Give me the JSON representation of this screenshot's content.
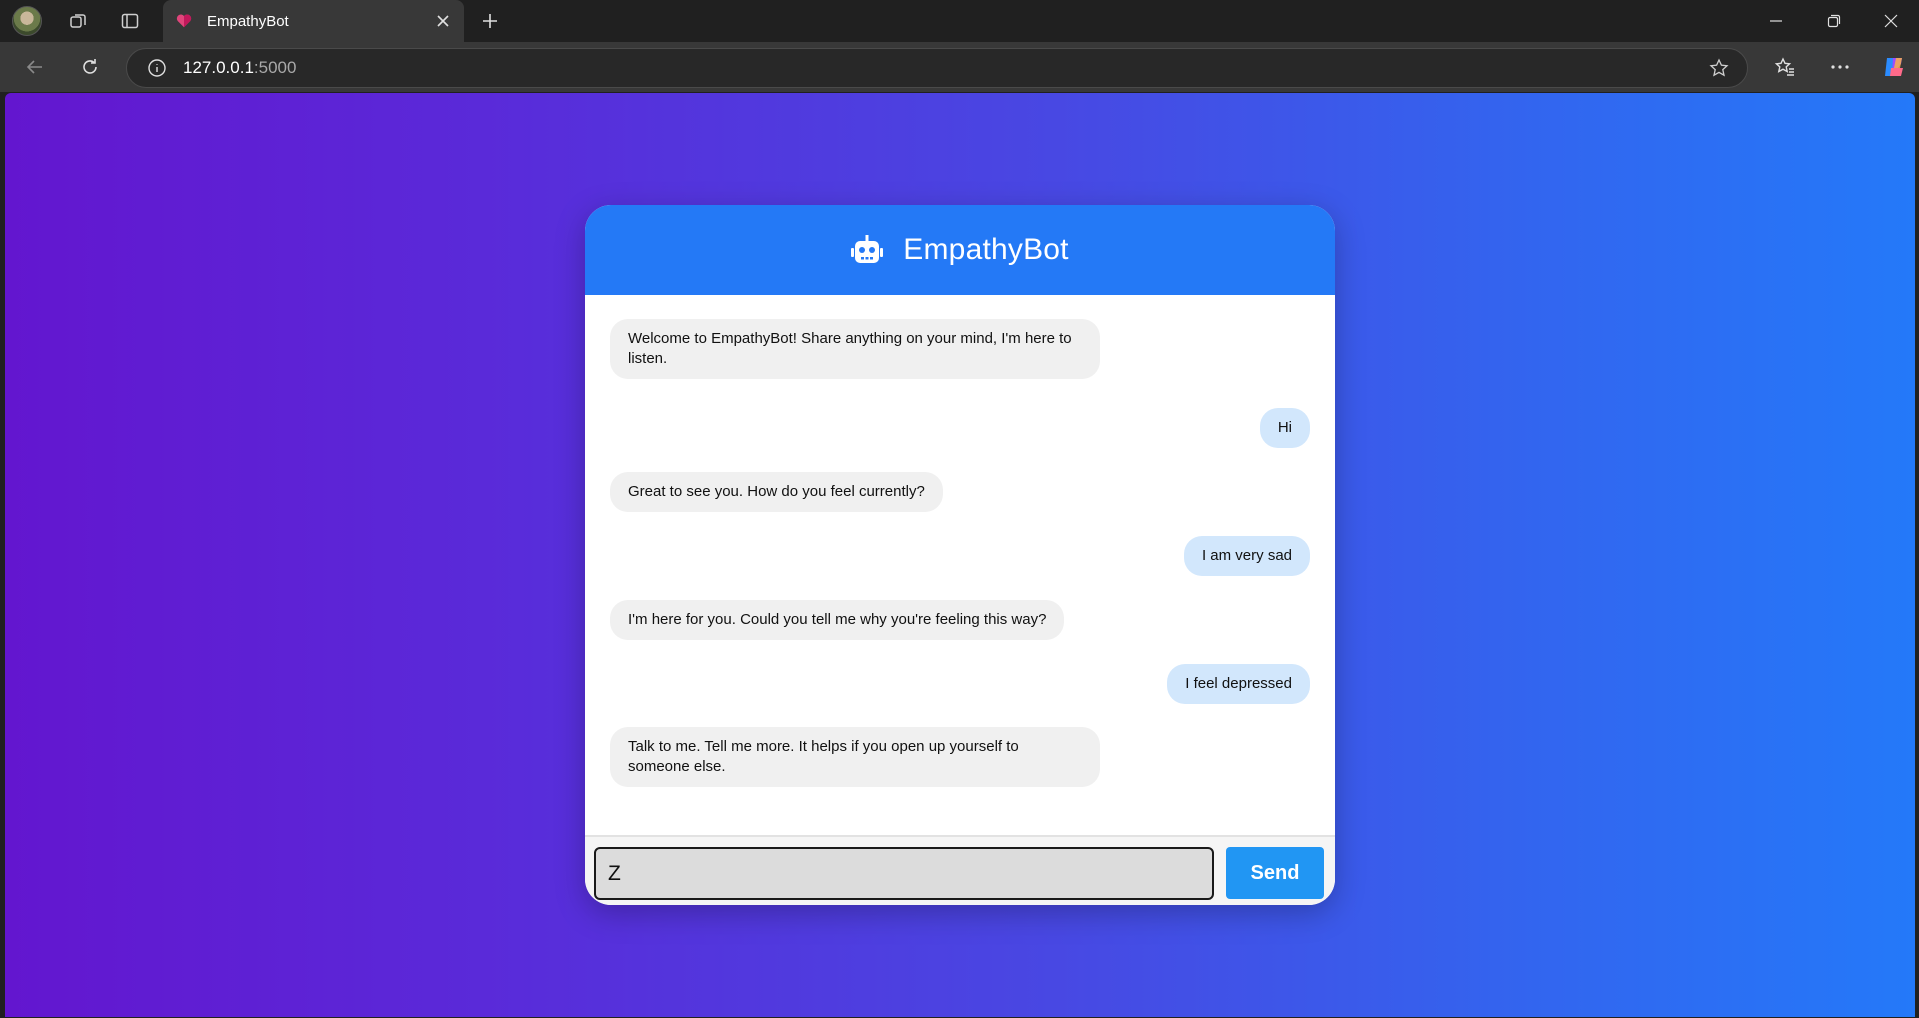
{
  "browser": {
    "tab_title": "EmpathyBot",
    "url_host": "127.0.0.1",
    "url_port": ":5000"
  },
  "chat": {
    "title": "EmpathyBot",
    "messages": [
      {
        "sender": "bot",
        "text": "Welcome to EmpathyBot! Share anything on your mind, I'm here to listen."
      },
      {
        "sender": "user",
        "text": "Hi"
      },
      {
        "sender": "bot",
        "text": "Great to see you. How do you feel currently?"
      },
      {
        "sender": "user",
        "text": "I am very sad"
      },
      {
        "sender": "bot",
        "text": "I'm here for you. Could you tell me why you're feeling this way?"
      },
      {
        "sender": "user",
        "text": "I feel depressed"
      },
      {
        "sender": "bot",
        "text": "Talk to me. Tell me more. It helps if you open up yourself to someone else."
      }
    ],
    "input_value": "Z",
    "send_label": "Send"
  },
  "colors": {
    "header": "#2479f6",
    "bot_bubble": "#f0f0f0",
    "user_bubble": "#d2e7fc",
    "send_button": "#2196f3"
  }
}
